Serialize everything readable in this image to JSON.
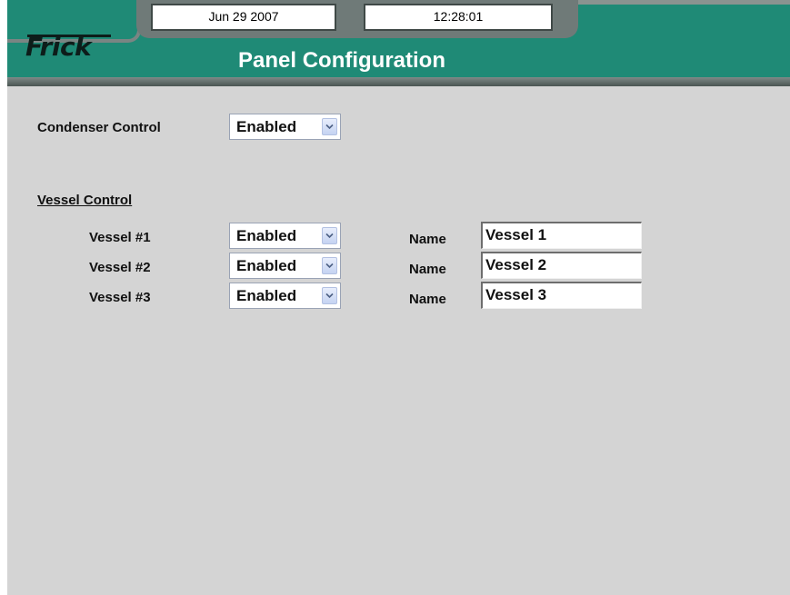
{
  "header": {
    "brand": "Frick",
    "date": "Jun 29 2007",
    "time": "12:28:01",
    "title": "Panel Configuration"
  },
  "condenser": {
    "label": "Condenser Control",
    "value": "Enabled"
  },
  "vessel_section": {
    "heading": "Vessel Control",
    "name_label": "Name",
    "vessels": [
      {
        "label": "Vessel #1",
        "status": "Enabled",
        "name": "Vessel 1"
      },
      {
        "label": "Vessel #2",
        "status": "Enabled",
        "name": "Vessel 2"
      },
      {
        "label": "Vessel #3",
        "status": "Enabled",
        "name": "Vessel 3"
      }
    ]
  },
  "icons": {
    "dropdown": "chevron-down-icon"
  },
  "colors": {
    "header_bg": "#1f8a76",
    "content_bg": "#d4d4d4",
    "title_text": "#ffffff"
  }
}
